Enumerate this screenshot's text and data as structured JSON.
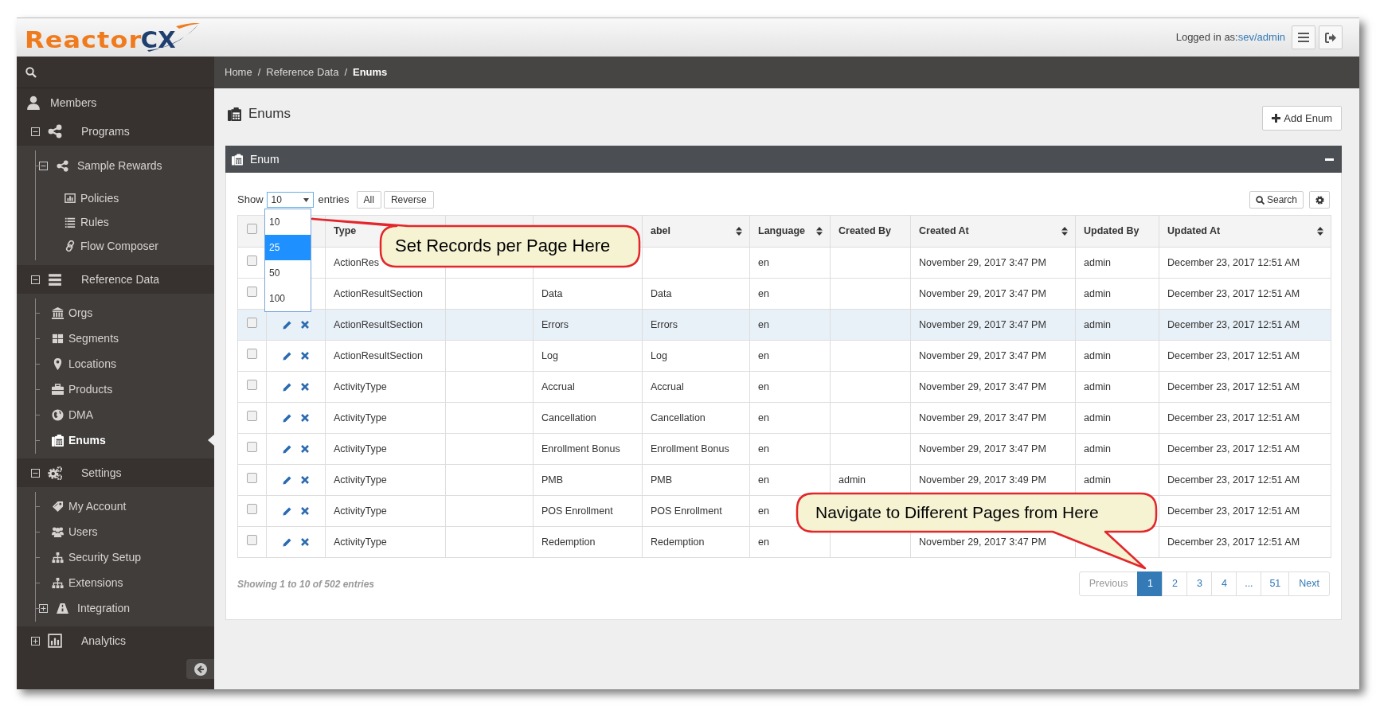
{
  "header": {
    "logo": {
      "part_1": "Reactor",
      "part_2": "CX"
    },
    "login_label": "Logged in as:",
    "login_user": "sev/admin"
  },
  "sidebar": {
    "items": [
      {
        "label": "Members",
        "selected": false
      },
      {
        "label": "Programs",
        "expanded": true,
        "selected": false,
        "children": [
          {
            "label": "Sample Rewards",
            "expanded": true,
            "selected": false,
            "children": [
              {
                "label": "Policies",
                "selected": false
              },
              {
                "label": "Rules",
                "selected": false
              },
              {
                "label": "Flow Composer",
                "selected": false
              }
            ]
          }
        ]
      },
      {
        "label": "Reference Data",
        "expanded": true,
        "selected": false,
        "children": [
          {
            "label": "Orgs",
            "selected": false
          },
          {
            "label": "Segments",
            "selected": false
          },
          {
            "label": "Locations",
            "selected": false
          },
          {
            "label": "Products",
            "selected": false
          },
          {
            "label": "DMA",
            "selected": false
          },
          {
            "label": "Enums",
            "selected": true
          }
        ]
      },
      {
        "label": "Settings",
        "expanded": true,
        "selected": false,
        "children": [
          {
            "label": "My Account",
            "selected": false
          },
          {
            "label": "Users",
            "selected": false
          },
          {
            "label": "Security Setup",
            "selected": false
          },
          {
            "label": "Extensions",
            "selected": false
          },
          {
            "label": "Integration",
            "expanded": false,
            "selected": false
          }
        ]
      },
      {
        "label": "Analytics",
        "expanded": false,
        "selected": false
      }
    ]
  },
  "breadcrumb": [
    {
      "label": "Home",
      "kind": "link"
    },
    {
      "label": "/",
      "kind": "separator"
    },
    {
      "label": "Reference Data",
      "kind": "link"
    },
    {
      "label": "/",
      "kind": "separator"
    },
    {
      "label": "Enums",
      "kind": "current"
    }
  ],
  "page": {
    "title": "Enums",
    "add_button": "Add Enum"
  },
  "panel": {
    "title": "Enum",
    "show_label": "Show",
    "page_size": "10",
    "entries_label": "entries",
    "buttons": [
      "All",
      "Reverse"
    ],
    "search_button": "Search",
    "page_size_options": [
      {
        "label": "10",
        "selected": false
      },
      {
        "label": "25",
        "selected": true
      },
      {
        "label": "50",
        "selected": false
      },
      {
        "label": "100",
        "selected": false
      }
    ]
  },
  "table": {
    "columns": [
      {
        "kind": "checkbox",
        "checked": false
      },
      {
        "kind": "actions"
      },
      {
        "kind": "text",
        "label": "Type"
      },
      {
        "kind": "text"
      },
      {
        "kind": "text"
      },
      {
        "kind": "text",
        "label": "abel",
        "sortable": true
      },
      {
        "kind": "text",
        "label": "Language",
        "sortable": true
      },
      {
        "kind": "text",
        "label": "Created By",
        "sortable": false
      },
      {
        "kind": "text",
        "label": "Created At",
        "sortable": true
      },
      {
        "kind": "text",
        "label": "Updated By",
        "sortable": false
      },
      {
        "kind": "text",
        "label": "Updated At",
        "sortable": true
      }
    ],
    "rows": [
      {
        "checked": false,
        "highlighted": false,
        "type": "ActionRes",
        "language": "en",
        "created_at": "November 29, 2017 3:47 PM",
        "updated_by": "admin",
        "updated_at": "December 23, 2017 12:51 AM"
      },
      {
        "checked": false,
        "highlighted": false,
        "type": "ActionResultSection",
        "column_5": "Data",
        "label": "Data",
        "language": "en",
        "created_at": "November 29, 2017 3:47 PM",
        "updated_by": "admin",
        "updated_at": "December 23, 2017 12:51 AM"
      },
      {
        "checked": false,
        "highlighted": true,
        "actions": true,
        "type": "ActionResultSection",
        "column_5": "Errors",
        "label": "Errors",
        "language": "en",
        "created_at": "November 29, 2017 3:47 PM",
        "updated_by": "admin",
        "updated_at": "December 23, 2017 12:51 AM"
      },
      {
        "checked": false,
        "highlighted": false,
        "actions": true,
        "type": "ActionResultSection",
        "column_5": "Log",
        "label": "Log",
        "language": "en",
        "created_at": "November 29, 2017 3:47 PM",
        "updated_by": "admin",
        "updated_at": "December 23, 2017 12:51 AM"
      },
      {
        "checked": false,
        "highlighted": false,
        "actions": true,
        "type": "ActivityType",
        "column_5": "Accrual",
        "label": "Accrual",
        "language": "en",
        "created_at": "November 29, 2017 3:47 PM",
        "updated_by": "admin",
        "updated_at": "December 23, 2017 12:51 AM"
      },
      {
        "checked": false,
        "highlighted": false,
        "actions": true,
        "type": "ActivityType",
        "column_5": "Cancellation",
        "label": "Cancellation",
        "language": "en",
        "created_at": "November 29, 2017 3:47 PM",
        "updated_by": "admin",
        "updated_at": "December 23, 2017 12:51 AM"
      },
      {
        "checked": false,
        "highlighted": false,
        "actions": true,
        "type": "ActivityType",
        "column_5": "Enrollment Bonus",
        "label": "Enrollment Bonus",
        "language": "en",
        "created_at": "November 29, 2017 3:47 PM",
        "updated_by": "admin",
        "updated_at": "December 23, 2017 12:51 AM"
      },
      {
        "checked": false,
        "highlighted": false,
        "actions": true,
        "type": "ActivityType",
        "column_5": "PMB",
        "label": "PMB",
        "language": "en",
        "created_by": "admin",
        "created_at": "November 29, 2017 3:49 PM",
        "updated_by": "admin",
        "updated_at": "December 23, 2017 12:51 AM"
      },
      {
        "checked": false,
        "highlighted": false,
        "actions": true,
        "type": "ActivityType",
        "column_5": "POS Enrollment",
        "label": "POS Enrollment",
        "language": "en",
        "updated_at": "December 23, 2017 12:51 AM"
      },
      {
        "checked": false,
        "highlighted": false,
        "actions": true,
        "type": "ActivityType",
        "column_5": "Redemption",
        "label": "Redemption",
        "language": "en",
        "created_at": "November 29, 2017 3:47 PM",
        "updated_at": "December 23, 2017 12:51 AM"
      }
    ]
  },
  "footer": {
    "summary": "Showing 1 to 10 of 502 entries",
    "pagination": [
      {
        "label": "Previous",
        "kind": "prev",
        "selected": false,
        "disabled": true
      },
      {
        "label": "1",
        "kind": "page",
        "selected": true,
        "disabled": false
      },
      {
        "label": "2",
        "kind": "page",
        "selected": false,
        "disabled": false
      },
      {
        "label": "3",
        "kind": "page",
        "selected": false,
        "disabled": false
      },
      {
        "label": "4",
        "kind": "page",
        "selected": false,
        "disabled": false
      },
      {
        "label": "...",
        "kind": "ellipsis",
        "selected": false,
        "disabled": false
      },
      {
        "label": "51",
        "kind": "page",
        "selected": false,
        "disabled": false
      },
      {
        "label": "Next",
        "kind": "next",
        "selected": false,
        "disabled": false
      }
    ]
  },
  "callouts": [
    {
      "text": "Set Records per Page Here"
    },
    {
      "text": "Navigate to Different Pages from Here"
    }
  ]
}
